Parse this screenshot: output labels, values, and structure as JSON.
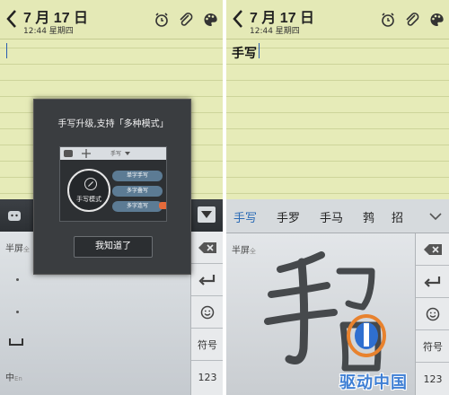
{
  "left": {
    "header": {
      "date": "7 月 17 日",
      "time": "12:44 星期四"
    },
    "keyboard": {
      "half_screen_label": "半屏",
      "half_screen_sub": "全",
      "lang_label": "中",
      "lang_sub": "En",
      "side_keys": [
        "symbols_label",
        "123"
      ],
      "symbols_label": "符号",
      "numbers_label": "123"
    },
    "dialog": {
      "title": "手写升级,支持「多种模式」",
      "preview_bar": {
        "label": "手写"
      },
      "mode_label": "手写模式",
      "options": [
        "单字手写",
        "多字叠写",
        "多字连写"
      ],
      "ok_button": "我知道了"
    }
  },
  "right": {
    "header": {
      "date": "7 月 17 日",
      "time": "12:44 星期四"
    },
    "note_text": "手写",
    "candidates": [
      "手写",
      "手罗",
      "手马",
      "鹁",
      "招"
    ],
    "keyboard": {
      "half_screen_label": "半屏",
      "half_screen_sub": "全",
      "symbols_label": "符号",
      "numbers_label": "123"
    }
  },
  "watermark": "驱动中国",
  "colors": {
    "paper": "#e6ebb8",
    "keyboard": "#d4d8dc",
    "accent": "#2b6bb5"
  }
}
